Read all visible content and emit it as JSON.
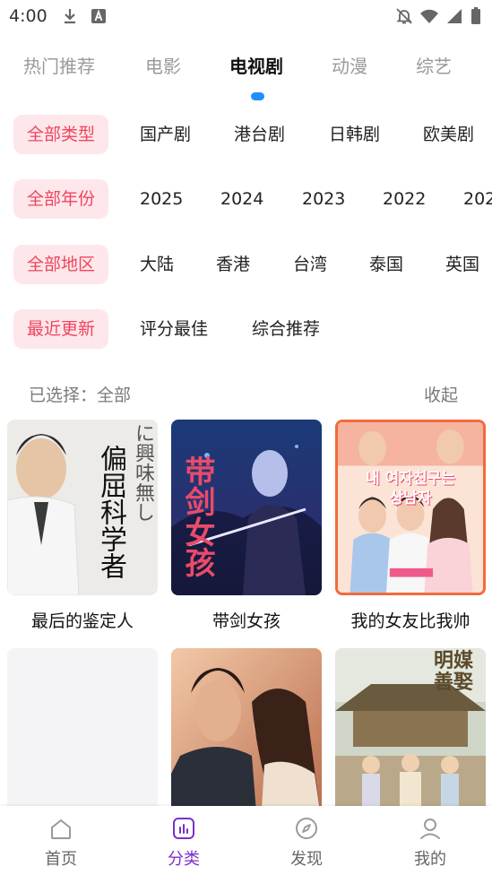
{
  "status_bar": {
    "time": "4:00",
    "left_icons": [
      "download-icon",
      "font-icon"
    ],
    "right_icons": [
      "notifications-off-icon",
      "wifi-icon",
      "signal-icon",
      "battery-icon"
    ]
  },
  "top_tabs": [
    {
      "label": "热门推荐",
      "active": false
    },
    {
      "label": "电影",
      "active": false
    },
    {
      "label": "电视剧",
      "active": true
    },
    {
      "label": "动漫",
      "active": false
    },
    {
      "label": "综艺",
      "active": false
    }
  ],
  "filters": {
    "type": [
      "全部类型",
      "国产剧",
      "港台剧",
      "日韩剧",
      "欧美剧"
    ],
    "year": [
      "全部年份",
      "2025",
      "2024",
      "2023",
      "2022",
      "202"
    ],
    "region": [
      "全部地区",
      "大陆",
      "香港",
      "台湾",
      "泰国",
      "英国"
    ],
    "sort": [
      "最近更新",
      "评分最佳",
      "综合推荐"
    ]
  },
  "selected": {
    "text": "已选择：全部",
    "collapse": "收起"
  },
  "shows": [
    {
      "title": "最后的鉴定人",
      "poster_text": [
        "偏屈",
        "科学者",
        "に興味",
        "無し"
      ]
    },
    {
      "title": "带剑女孩",
      "poster_text": [
        "带剑",
        "女孩"
      ]
    },
    {
      "title": "我的女友比我帅",
      "poster_text": [
        "내 여자친구는",
        "상남자"
      ]
    },
    {
      "title": "",
      "poster_text": []
    },
    {
      "title": "",
      "poster_text": []
    },
    {
      "title": "",
      "poster_text": [
        "明媒",
        "善娶"
      ]
    }
  ],
  "bottom_nav": [
    {
      "label": "首页",
      "icon": "home-icon",
      "active": false
    },
    {
      "label": "分类",
      "icon": "category-icon",
      "active": true
    },
    {
      "label": "发现",
      "icon": "compass-icon",
      "active": false
    },
    {
      "label": "我的",
      "icon": "user-icon",
      "active": false
    }
  ],
  "colors": {
    "accent_red": "#f0445e",
    "chip_bg": "#fde7ea",
    "indicator_blue": "#1e8fff",
    "nav_active": "#7b2fc9"
  }
}
